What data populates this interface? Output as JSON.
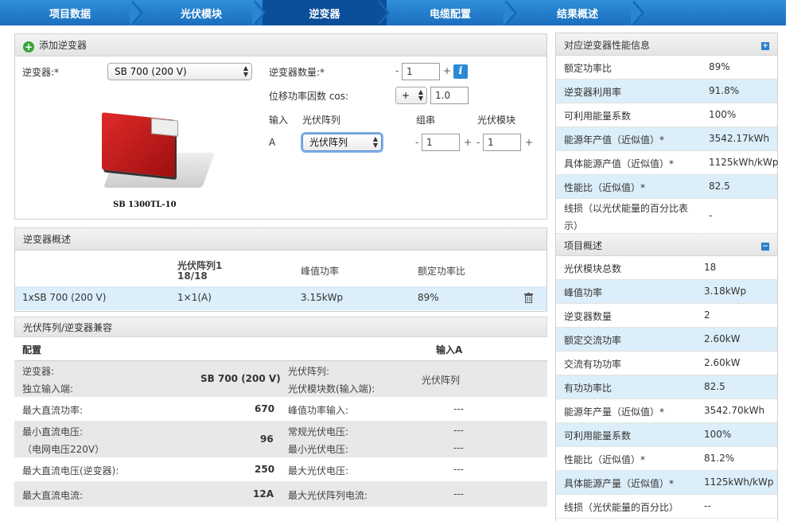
{
  "nav": {
    "steps": [
      "项目数据",
      "光伏模块",
      "逆变器",
      "电缆配置",
      "结果概述"
    ]
  },
  "add_panel": {
    "title": "添加逆变器",
    "inverter_label": "逆变器:*",
    "inverter_value": "SB 700 (200 V)",
    "count_label": "逆变器数量:*",
    "count_value": "1",
    "cos_label": "位移功率因数 cos:",
    "cos_sign": "+",
    "cos_value": "1.0",
    "col_input": "输入",
    "col_array": "光伏阵列",
    "col_string": "组串",
    "col_module": "光伏模块",
    "row_input": "A",
    "row_array_value": "光伏阵列",
    "row_string_value": "1",
    "row_module_value": "1",
    "minus": "-",
    "plus": "+",
    "image_caption": "SB 1300TL-10"
  },
  "overview": {
    "title": "逆变器概述",
    "col1_line1": "光伏阵列1",
    "col1_line2": "18/18",
    "col2": "峰值功率",
    "col3": "额定功率比",
    "row": {
      "name": "1xSB 700 (200 V)",
      "array": "1×1(A)",
      "peak": "3.15kWp",
      "ratio": "89%"
    }
  },
  "compat": {
    "title": "光伏阵列/逆变器兼容",
    "config_label": "配置",
    "input_label": "输入A",
    "rows": [
      {
        "k1": "逆变器:",
        "k1b": "独立输入端:",
        "v1": "SB 700 (200 V)",
        "k2": "光伏阵列:",
        "k2b": "光伏模块数(输入端):",
        "v2": "光伏阵列"
      },
      {
        "k1": "最大直流功率:",
        "v1": "670",
        "k2": "峰值功率输入:",
        "v2": "---"
      },
      {
        "k1": "最小直流电压:",
        "k1b": "（电网电压220V）",
        "v1": "96",
        "k2": "常规光伏电压:",
        "k2b": "最小光伏电压:",
        "v2": "---",
        "v2b": "---"
      },
      {
        "k1": "最大直流电压(逆变器):",
        "v1": "250",
        "k2": "最大光伏电压:",
        "v2": "---"
      },
      {
        "k1": "最大直流电流:",
        "v1": "12A",
        "k2": "最大光伏阵列电流:",
        "v2": "---"
      }
    ]
  },
  "right": {
    "perf_title": "对应逆变器性能信息",
    "perf_rows": [
      {
        "k": "额定功率比",
        "v": "89%"
      },
      {
        "k": "逆变器利用率",
        "v": "91.8%"
      },
      {
        "k": "可利用能量系数",
        "v": "100%"
      },
      {
        "k": "能源年产值（近似值）*",
        "v": "3542.17kWh"
      },
      {
        "k": "具体能源产值（近似值）*",
        "v": "1125kWh/kWp"
      },
      {
        "k": "性能比（近似值）*",
        "v": "82.5"
      },
      {
        "k": "线损（以光伏能量的百分比表",
        "k2": "示）",
        "v": "-"
      }
    ],
    "proj_title": "项目概述",
    "proj_rows": [
      {
        "k": "光伏模块总数",
        "v": "18"
      },
      {
        "k": "峰值功率",
        "v": "3.18kWp"
      },
      {
        "k": "逆变器数量",
        "v": "2"
      },
      {
        "k": "额定交流功率",
        "v": "2.60kW"
      },
      {
        "k": "交流有功功率",
        "v": "2.60kW"
      },
      {
        "k": "有功功率比",
        "v": "82.5"
      },
      {
        "k": "能源年产量（近似值）*",
        "v": "3542.70kWh"
      },
      {
        "k": "可利用能量系数",
        "v": "100%"
      },
      {
        "k": "性能比（近似值）*",
        "v": "81.2%"
      },
      {
        "k": "具体能源产量（近似值）*",
        "v": "1125kWh/kWp"
      },
      {
        "k": "线损（光伏能量的百分比）",
        "v": "--"
      }
    ],
    "plus_glyph": "+",
    "minus_glyph": "−"
  }
}
